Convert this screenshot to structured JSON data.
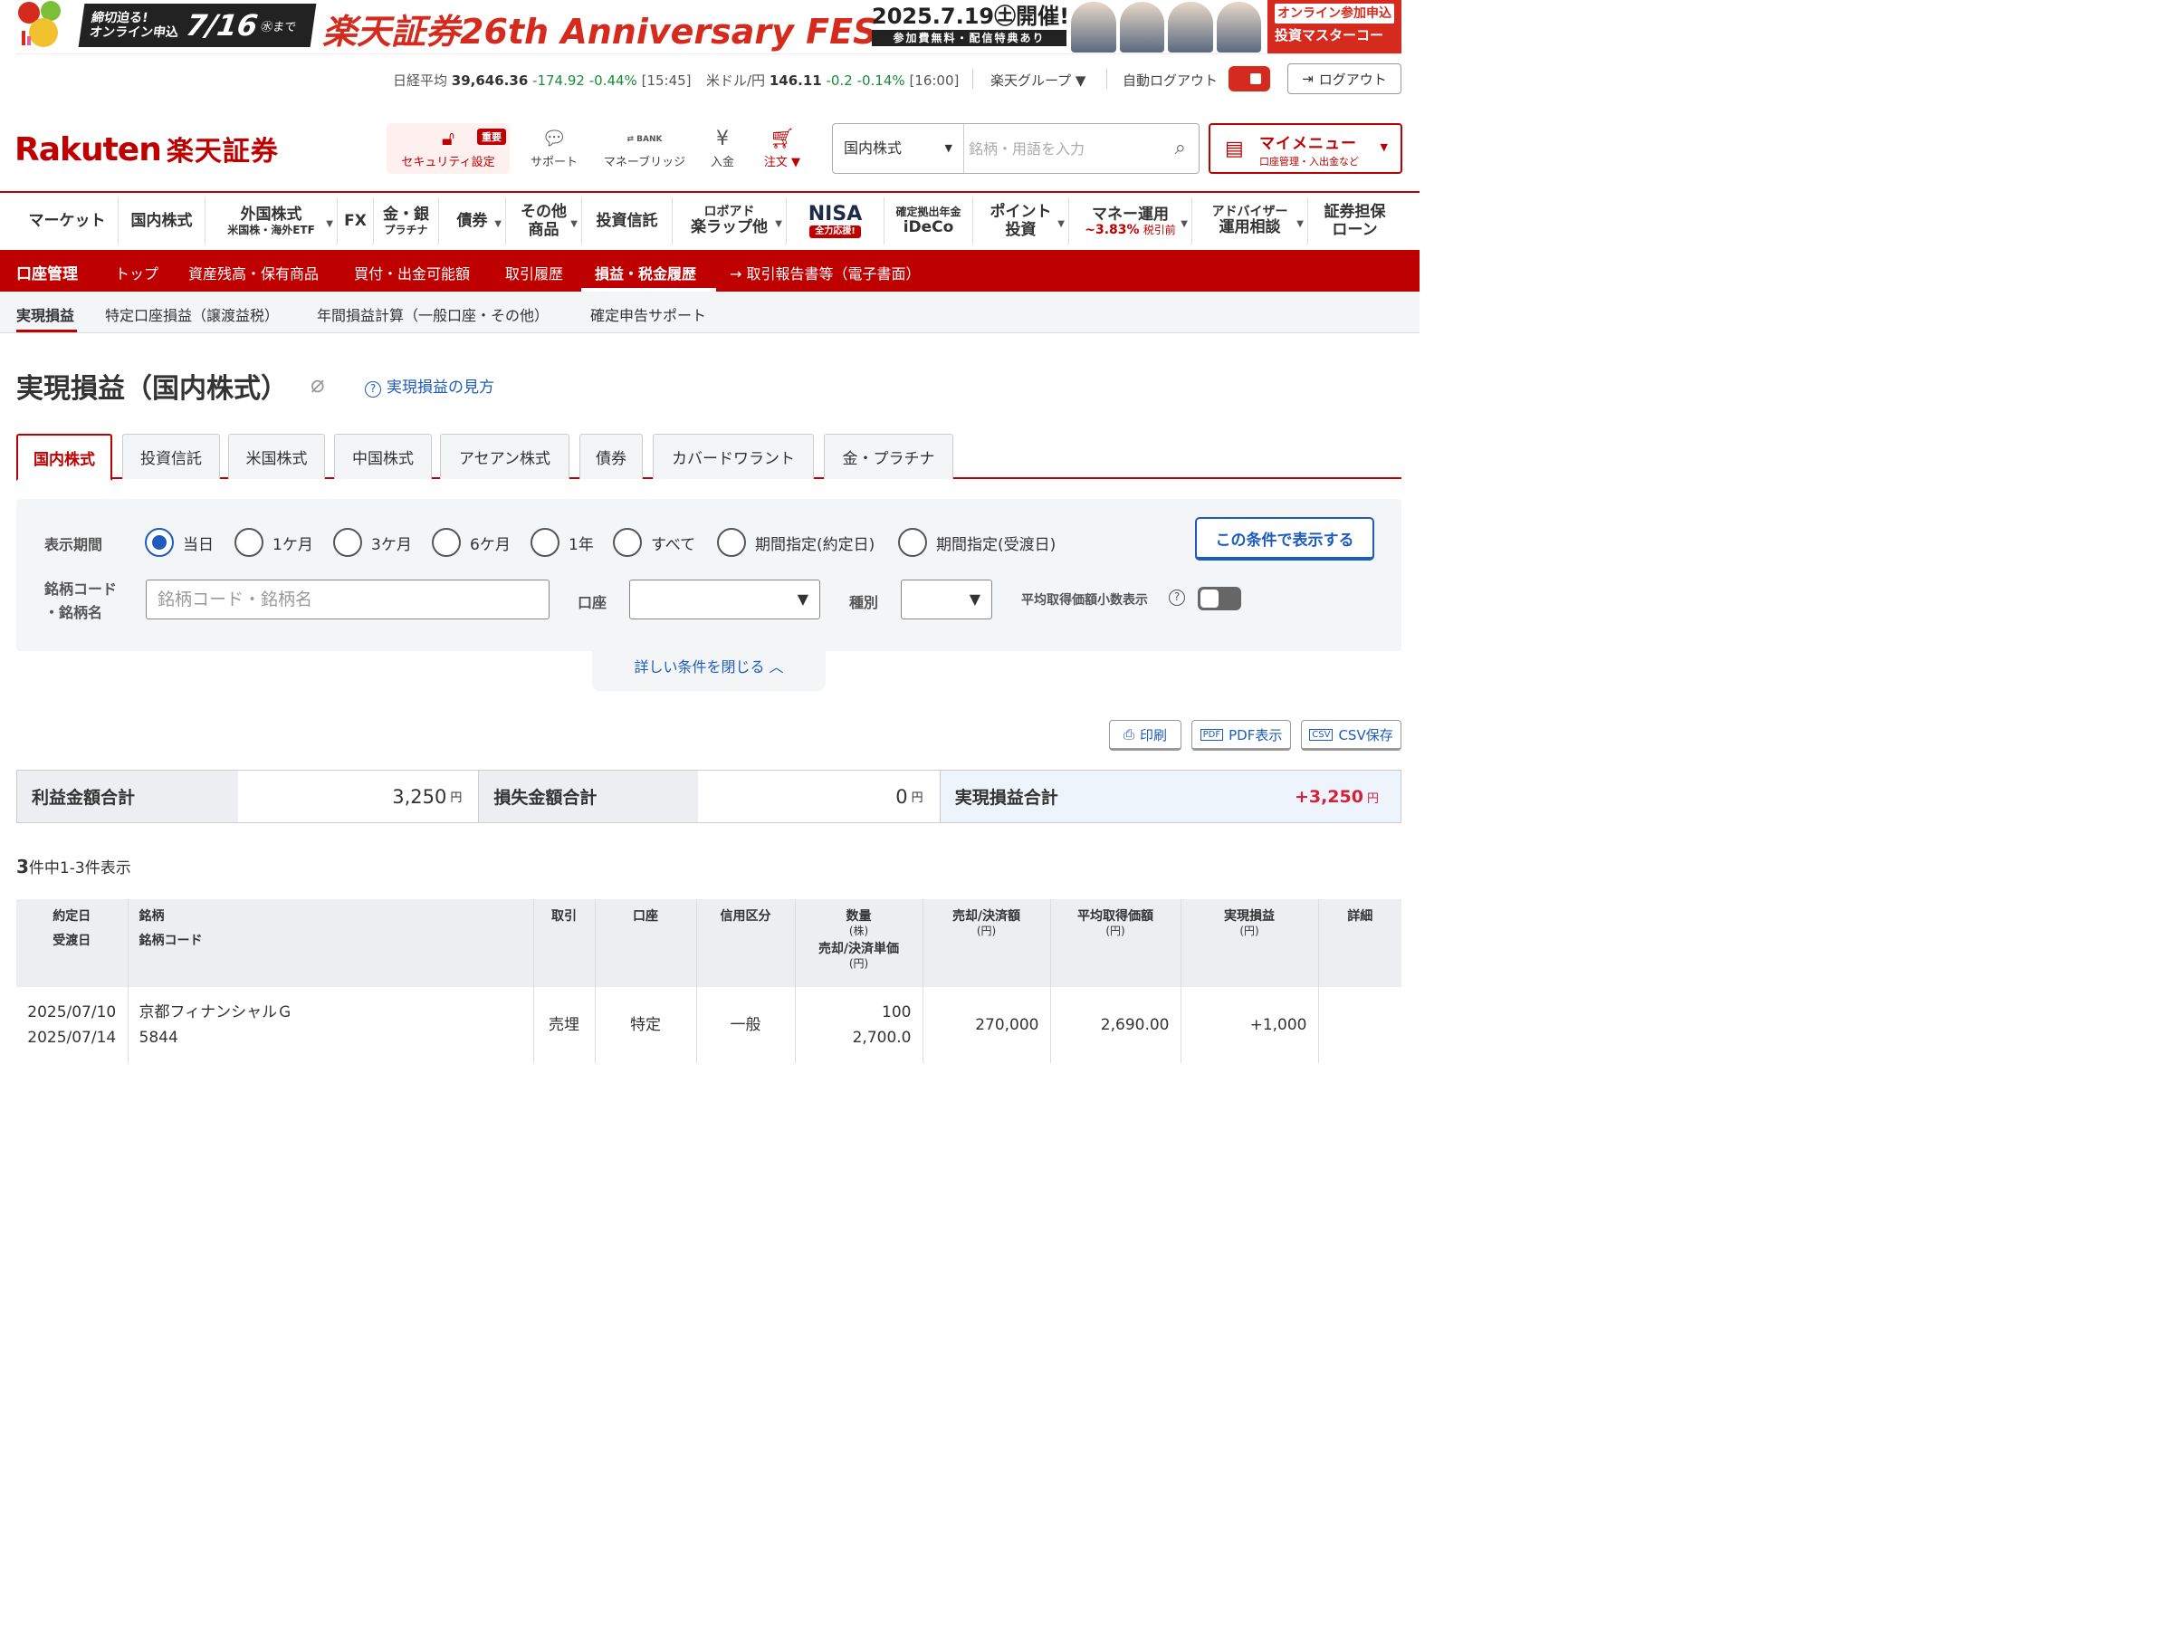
{
  "banner": {
    "deadline_line1": "締切迫る!",
    "deadline_line2": "オンライン申込",
    "deadline_date": "7/16",
    "deadline_suffix": "㊌まで",
    "fes_title": "楽天証券26th Anniversary FES",
    "fes_date": "2025.7.19㊏開催!",
    "fes_sub": "参加費無料・配信特典あり",
    "online_top": "オンライン参加申込",
    "online_bottom": "投資マスターコース"
  },
  "market": {
    "nikkei_label": "日経平均",
    "nikkei_value": "39,646.36",
    "nikkei_change": "-174.92",
    "nikkei_pct": "-0.44%",
    "nikkei_time": "[15:45]",
    "usd_label": "米ドル/円",
    "usd_value": "146.11",
    "usd_change": "-0.2",
    "usd_pct": "-0.14%",
    "usd_time": "[16:00]",
    "group_label": "楽天グループ ▼",
    "auto_logout_label": "自動ログアウト",
    "logout_label": "ログアウト"
  },
  "header": {
    "logo_en": "Rakuten",
    "logo_jp": "楽天証券",
    "security_label": "セキュリティ設定",
    "security_badge": "重要",
    "support_label": "サポート",
    "bridge_label": "マネーブリッジ",
    "bridge_icon_text": "BANK",
    "deposit_label": "入金",
    "order_label": "注文 ▼",
    "search_category": "国内株式",
    "search_placeholder": "銘柄・用語を入力",
    "mymenu_title": "マイメニュー",
    "mymenu_sub": "口座管理・入出金など"
  },
  "gnav": {
    "market": "マーケット",
    "domestic": "国内株式",
    "foreign": "外国株式",
    "foreign_sub": "米国株・海外ETF",
    "fx": "FX",
    "gold": "金・銀",
    "gold_sub": "プラチナ",
    "bonds": "債券",
    "other": "その他",
    "other_sub": "商品",
    "funds": "投資信託",
    "roboad": "ロボアド",
    "roboad_sub": "楽ラップ他",
    "nisa": "NISA",
    "nisa_badge": "全力応援!",
    "ideco_top": "確定拠出年金",
    "ideco": "iDeCo",
    "point": "ポイント",
    "point_sub": "投資",
    "money": "マネー運用",
    "money_rate": "~3.83%",
    "money_tax": "税引前",
    "advisor": "アドバイザー",
    "advisor_sub": "運用相談",
    "loan": "証券担保",
    "loan_sub": "ローン"
  },
  "accnav": {
    "title": "口座管理",
    "items": [
      "トップ",
      "資産残高・保有商品",
      "買付・出金可能額",
      "取引履歴",
      "損益・税金履歴",
      "→ 取引報告書等（電子書面）"
    ]
  },
  "subnav": {
    "items": [
      "実現損益",
      "特定口座損益（譲渡益税）",
      "年間損益計算（一般口座・その他）",
      "確定申告サポート"
    ]
  },
  "page": {
    "title": "実現損益（国内株式）",
    "howto": "実現損益の見方"
  },
  "tabs": [
    "国内株式",
    "投資信託",
    "米国株式",
    "中国株式",
    "アセアン株式",
    "債券",
    "カバードワラント",
    "金・プラチナ"
  ],
  "filter": {
    "period_label": "表示期間",
    "periods": [
      "当日",
      "1ケ月",
      "3ケ月",
      "6ケ月",
      "1年",
      "すべて",
      "期間指定(約定日)",
      "期間指定(受渡日)"
    ],
    "show_button": "この条件で表示する",
    "code_label_1": "銘柄コード",
    "code_label_2": "・銘柄名",
    "code_placeholder": "銘柄コード・銘柄名",
    "account_label": "口座",
    "type_label": "種別",
    "avg_label": "平均取得価額小数表示",
    "close_label": "詳しい条件を閉じる ︿"
  },
  "actions": {
    "print": "印刷",
    "pdf": "PDF表示",
    "csv": "CSV保存"
  },
  "summary": {
    "profit_label": "利益金額合計",
    "profit_value": "3,250",
    "loss_label": "損失金額合計",
    "loss_value": "0",
    "total_label": "実現損益合計",
    "total_value": "+3,250",
    "yen": "円"
  },
  "count": {
    "total": "3",
    "text": "件中1-3件表示"
  },
  "table": {
    "headers": {
      "date1": "約定日",
      "date2": "受渡日",
      "name1": "銘柄",
      "name2": "銘柄コード",
      "trade": "取引",
      "account": "口座",
      "margin": "信用区分",
      "qty": "数量",
      "qty_unit": "(株)",
      "price": "売却/決済単価",
      "yen_unit": "(円)",
      "amount": "売却/決済額",
      "avg": "平均取得価額",
      "pnl": "実現損益",
      "detail": "詳細"
    },
    "rows": [
      {
        "trade_date": "2025/07/10",
        "settle_date": "2025/07/14",
        "name": "京都フィナンシャルＧ",
        "code": "5844",
        "trade": "売埋",
        "account": "特定",
        "margin": "一般",
        "qty": "100",
        "price": "2,700.0",
        "amount": "270,000",
        "avg": "2,690.00",
        "pnl": "+1,000"
      }
    ]
  }
}
